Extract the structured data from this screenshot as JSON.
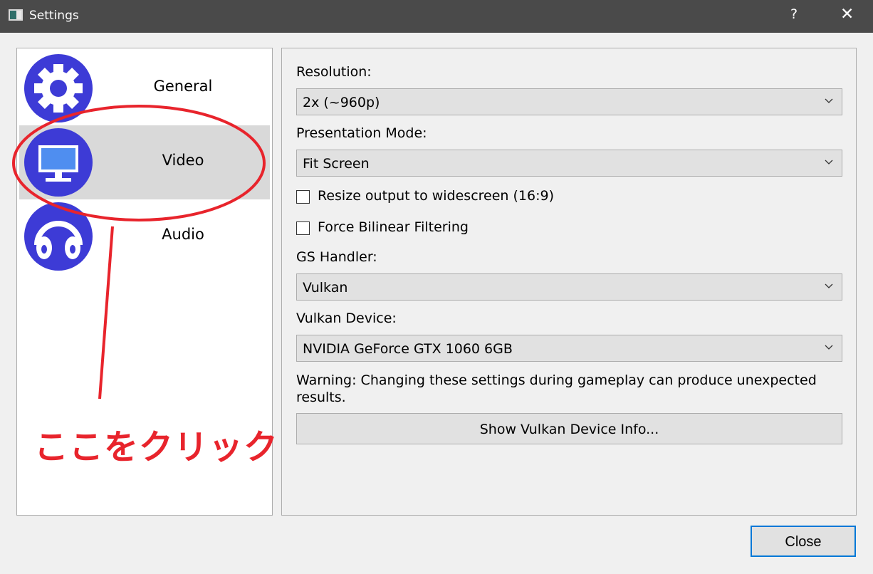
{
  "window": {
    "title": "Settings",
    "help_label": "?",
    "close_label": "✕"
  },
  "sidebar": {
    "items": [
      {
        "label": "General",
        "icon": "gear-icon",
        "selected": false
      },
      {
        "label": "Video",
        "icon": "monitor-icon",
        "selected": true
      },
      {
        "label": "Audio",
        "icon": "headphones-icon",
        "selected": false
      }
    ]
  },
  "annotation": {
    "text": "ここをクリック",
    "color": "#e8242c"
  },
  "video": {
    "resolution_label": "Resolution:",
    "resolution_value": "2x (~960p)",
    "presentation_label": "Presentation Mode:",
    "presentation_value": "Fit Screen",
    "widescreen_label": "Resize output to widescreen (16:9)",
    "widescreen_checked": false,
    "bilinear_label": "Force Bilinear Filtering",
    "bilinear_checked": false,
    "gs_handler_label": "GS Handler:",
    "gs_handler_value": "Vulkan",
    "vulkan_device_label": "Vulkan Device:",
    "vulkan_device_value": "NVIDIA GeForce GTX 1060 6GB",
    "warning_text": "Warning: Changing these settings during gameplay can produce unexpected results.",
    "show_info_label": "Show Vulkan Device Info..."
  },
  "footer": {
    "close_label": "Close"
  },
  "colors": {
    "titlebar": "#4a4a4a",
    "icon_blue": "#3d3bd6",
    "selected_bg": "#d9d9d9",
    "focus_border": "#0078d7"
  }
}
